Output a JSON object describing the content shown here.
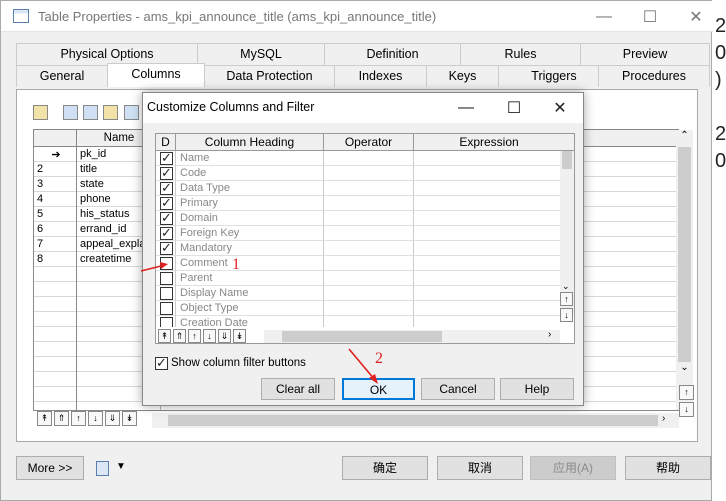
{
  "window": {
    "title": "Table Properties - ams_kpi_announce_title (ams_kpi_announce_title)"
  },
  "background_partial_text": [
    "2",
    "0",
    ")",
    "2",
    "0"
  ],
  "tabs_row1": [
    "Physical Options",
    "MySQL",
    "Definition",
    "Rules",
    "Preview"
  ],
  "tabs_row2": [
    "General",
    "Columns",
    "Data Protection",
    "Indexes",
    "Keys",
    "Triggers",
    "Procedures"
  ],
  "columns_grid": {
    "header_name": "Name",
    "rows": [
      {
        "num": "",
        "name": "pk_id",
        "current": true
      },
      {
        "num": "2",
        "name": "title"
      },
      {
        "num": "3",
        "name": "state"
      },
      {
        "num": "4",
        "name": "phone"
      },
      {
        "num": "5",
        "name": "his_status"
      },
      {
        "num": "6",
        "name": "errand_id"
      },
      {
        "num": "7",
        "name": "appeal_expla"
      },
      {
        "num": "8",
        "name": "createtime"
      }
    ]
  },
  "bottom": {
    "more_label": "More >>",
    "ok_label": "确定",
    "cancel_label": "取消",
    "apply_label": "应用(A)",
    "help_label": "帮助"
  },
  "dialog": {
    "title": "Customize Columns and Filter",
    "headers": {
      "d": "D",
      "heading": "Column Heading",
      "operator": "Operator",
      "expression": "Expression"
    },
    "items": [
      {
        "label": "Name",
        "checked": true
      },
      {
        "label": "Code",
        "checked": true
      },
      {
        "label": "Data Type",
        "checked": true
      },
      {
        "label": "Primary",
        "checked": true
      },
      {
        "label": "Domain",
        "checked": true
      },
      {
        "label": "Foreign Key",
        "checked": true
      },
      {
        "label": "Mandatory",
        "checked": true
      },
      {
        "label": "Comment",
        "checked": false
      },
      {
        "label": "Parent",
        "checked": false
      },
      {
        "label": "Display Name",
        "checked": false
      },
      {
        "label": "Object Type",
        "checked": false
      },
      {
        "label": "Creation Date",
        "checked": false
      }
    ],
    "show_filter_label": "Show column filter buttons",
    "show_filter_checked": true,
    "clear_all_label": "Clear all",
    "ok_label": "OK",
    "cancel_label": "Cancel",
    "help_label": "Help"
  },
  "annotations": {
    "marker1": "1",
    "marker2": "2"
  },
  "colors": {
    "accent_border": "#0078d7",
    "annotation_red": "#e02020"
  }
}
